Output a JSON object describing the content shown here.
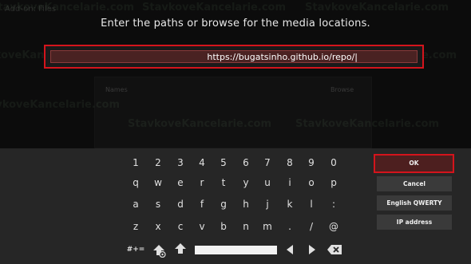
{
  "background": {
    "breadcrumb": "Add-on: Files",
    "left_label": "Names",
    "right_label": "Browse",
    "watermark": "StavkoveKancelarie.com"
  },
  "dialog": {
    "heading": "Enter the paths or browse for the media locations.",
    "input_value": "https://bugatsinho.github.io/repo/|"
  },
  "keyboard": {
    "rows": [
      [
        "1",
        "2",
        "3",
        "4",
        "5",
        "6",
        "7",
        "8",
        "9",
        "0"
      ],
      [
        "q",
        "w",
        "e",
        "r",
        "t",
        "y",
        "u",
        "i",
        "o",
        "p"
      ],
      [
        "a",
        "s",
        "d",
        "f",
        "g",
        "h",
        "j",
        "k",
        "l",
        ":"
      ],
      [
        "z",
        "x",
        "c",
        "v",
        "b",
        "n",
        "m",
        ".",
        "/",
        "@"
      ]
    ],
    "symbols_label": "#+="
  },
  "side_buttons": {
    "ok": "OK",
    "cancel": "Cancel",
    "layout": "English QWERTY",
    "ip": "IP address"
  },
  "colors": {
    "focus_border": "#d4141c",
    "keyboard_bg": "#262626",
    "button_bg": "#3a3a3a"
  }
}
